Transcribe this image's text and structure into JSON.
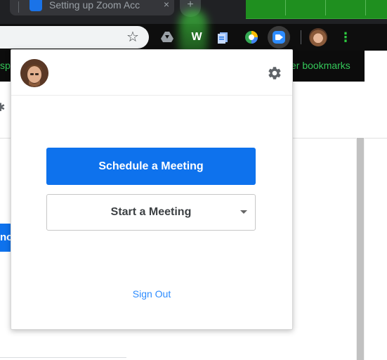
{
  "browser": {
    "tab_title": "Setting up Zoom Acc",
    "tab_close_glyph": "×",
    "new_tab_glyph": "+",
    "bookmark_left_fragment": "sp",
    "bookmark_right_fragment": "er bookmarks",
    "extensions": [
      "drive-icon",
      "w-extension-icon",
      "docs-icon",
      "chrome-colors-icon",
      "zoom-scheduler-icon"
    ],
    "ext_w_label": "W",
    "menu_glyph": "⋮"
  },
  "page": {
    "blue_button_fragment": "no"
  },
  "popup": {
    "schedule_label": "Schedule a Meeting",
    "start_label": "Start a Meeting",
    "signout_label": "Sign Out"
  },
  "colors": {
    "zoom_blue": "#0e72ed",
    "link_blue": "#2d8cff",
    "accent_green": "#34c759"
  }
}
